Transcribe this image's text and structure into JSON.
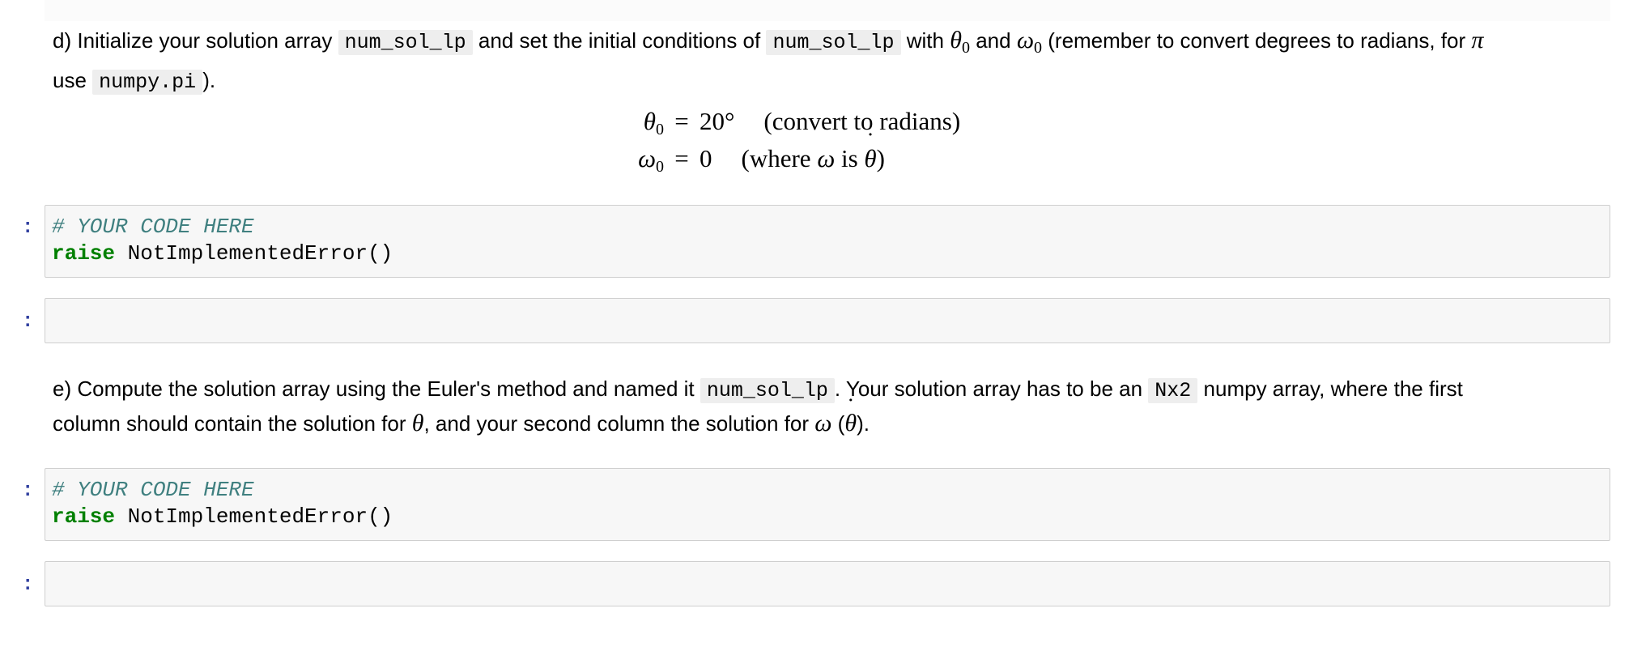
{
  "cell_d": {
    "label": "d) Initialize your solution array",
    "var": "num_sol_lp",
    "text2": "and set the initial conditions of",
    "text3": "with",
    "theta0_sym": "θ",
    "omega0_sym": "ω",
    "sub0": "0",
    "text4": "and",
    "text5": "(remember to convert degrees to radians, for",
    "pi": "π",
    "text6": "use",
    "pi_code": "numpy.pi",
    "text7": ")."
  },
  "equations": {
    "eq1_lhs": "θ",
    "eq1_sub": "0",
    "eq1_rel": "=",
    "eq1_rhs": "20°",
    "eq1_note": "(convert to radians)",
    "eq2_lhs": "ω",
    "eq2_sub": "0",
    "eq2_rel": "=",
    "eq2_rhs": "0",
    "eq2_note_a": "(where",
    "eq2_note_omega": "ω",
    "eq2_note_b": "is",
    "eq2_note_theta": "θ",
    "eq2_note_c": ")"
  },
  "prompt_char": ":",
  "code_cells": [
    {
      "comment": "# YOUR CODE HERE",
      "keyword": "raise",
      "rest": " NotImplementedError()"
    },
    {
      "comment": "# YOUR CODE HERE",
      "keyword": "raise",
      "rest": " NotImplementedError()"
    }
  ],
  "cell_e": {
    "label": "e) Compute the solution array using the Euler's method and named it",
    "var": "num_sol_lp",
    "text2": ". Your solution array has to be an",
    "shape": "Nx2",
    "text3": "numpy array, where the first",
    "text4": "column should contain the solution for",
    "theta": "θ",
    "text5": ", and your second column the solution for",
    "omega": "ω",
    "text6": "(",
    "theta_dot": "θ",
    "text7": ")."
  }
}
